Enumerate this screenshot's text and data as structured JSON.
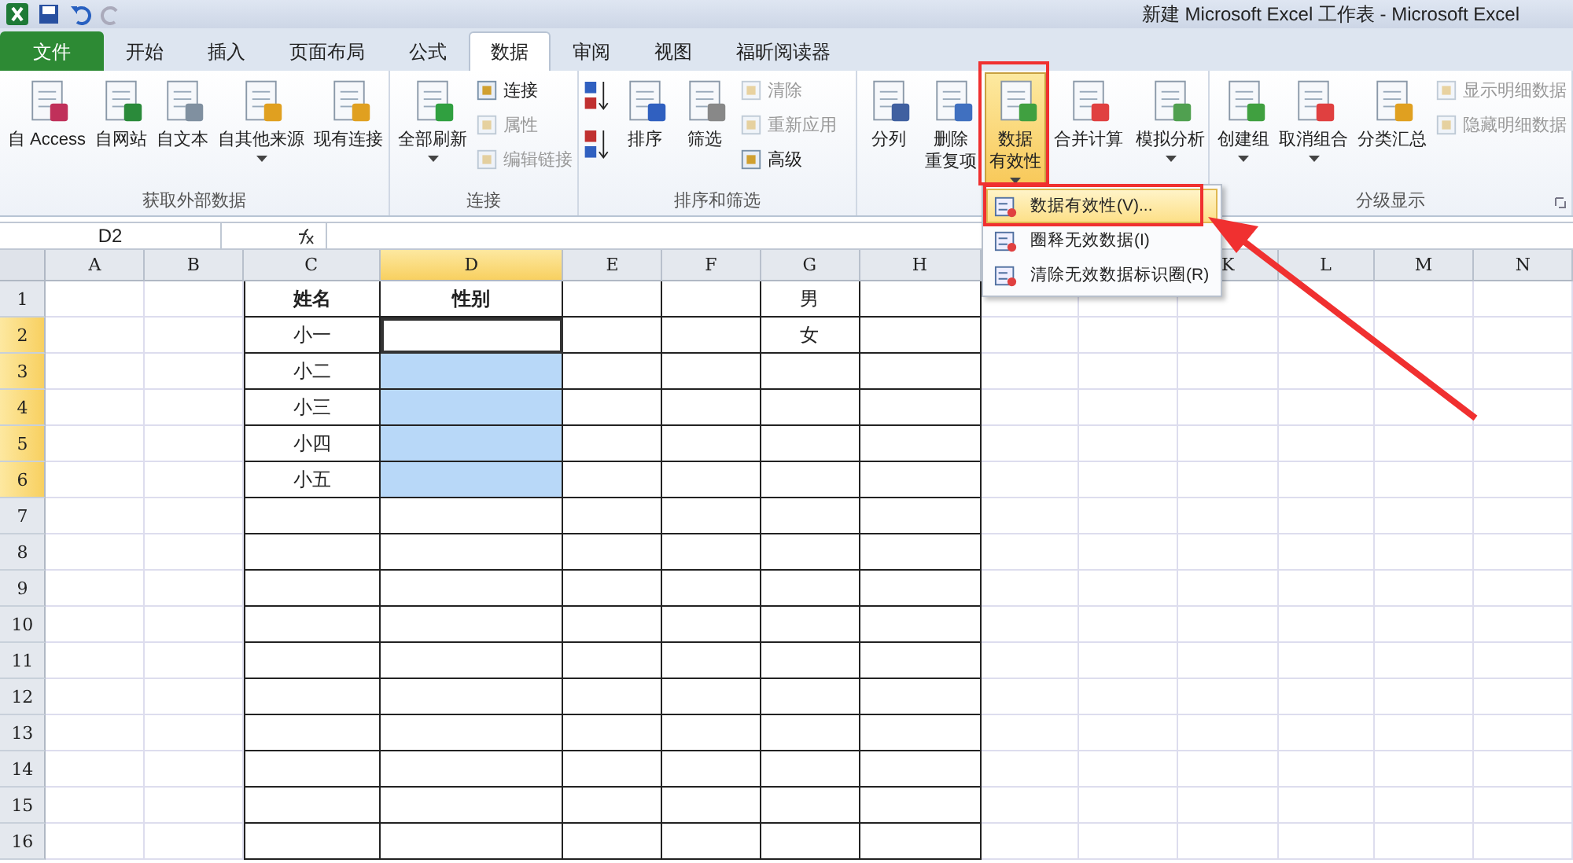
{
  "window": {
    "title": "新建 Microsoft Excel 工作表  -  Microsoft Excel"
  },
  "tabs": [
    {
      "label": "文件",
      "kind": "file",
      "selected": false
    },
    {
      "label": "开始",
      "kind": "tab",
      "selected": false
    },
    {
      "label": "插入",
      "kind": "tab",
      "selected": false
    },
    {
      "label": "页面布局",
      "kind": "tab",
      "selected": false
    },
    {
      "label": "公式",
      "kind": "tab",
      "selected": false
    },
    {
      "label": "数据",
      "kind": "tab",
      "selected": true
    },
    {
      "label": "审阅",
      "kind": "tab",
      "selected": false
    },
    {
      "label": "视图",
      "kind": "tab",
      "selected": false
    },
    {
      "label": "福昕阅读器",
      "kind": "tab",
      "selected": false
    }
  ],
  "ribbon": {
    "groups": [
      {
        "label": "获取外部数据",
        "items": [
          {
            "kind": "large",
            "lines": [
              "自 Access"
            ],
            "dropdown": false,
            "disabled": false,
            "pressed": false
          },
          {
            "kind": "large",
            "lines": [
              "自网站"
            ],
            "dropdown": false,
            "disabled": false,
            "pressed": false
          },
          {
            "kind": "large",
            "lines": [
              "自文本"
            ],
            "dropdown": false,
            "disabled": false,
            "pressed": false
          },
          {
            "kind": "large",
            "lines": [
              "自其他来源"
            ],
            "dropdown": true,
            "disabled": false,
            "pressed": false
          },
          {
            "kind": "large",
            "lines": [
              "现有连接"
            ],
            "dropdown": false,
            "disabled": false,
            "pressed": false
          }
        ]
      },
      {
        "label": "连接",
        "items": [
          {
            "kind": "large",
            "lines": [
              "全部刷新"
            ],
            "dropdown": true,
            "disabled": false,
            "pressed": false
          },
          {
            "kind": "stack",
            "items": [
              {
                "label": "连接",
                "disabled": false
              },
              {
                "label": "属性",
                "disabled": true
              },
              {
                "label": "编辑链接",
                "disabled": true
              }
            ]
          }
        ]
      },
      {
        "label": "排序和筛选",
        "items": [
          {
            "kind": "sortstack"
          },
          {
            "kind": "large",
            "lines": [
              "排序"
            ],
            "dropdown": false,
            "disabled": false,
            "pressed": false
          },
          {
            "kind": "large",
            "lines": [
              "筛选"
            ],
            "dropdown": false,
            "disabled": false,
            "pressed": false
          },
          {
            "kind": "stack",
            "items": [
              {
                "label": "清除",
                "disabled": true
              },
              {
                "label": "重新应用",
                "disabled": true
              },
              {
                "label": "高级",
                "disabled": false
              }
            ]
          }
        ]
      },
      {
        "items": [
          {
            "kind": "large",
            "lines": [
              "分列"
            ],
            "dropdown": false,
            "disabled": false,
            "pressed": false
          },
          {
            "kind": "large",
            "lines": [
              "删除",
              "重复项"
            ],
            "dropdown": false,
            "disabled": false,
            "pressed": false
          },
          {
            "kind": "large",
            "lines": [
              "数据",
              "有效性"
            ],
            "dropdown": true,
            "disabled": false,
            "pressed": true
          },
          {
            "kind": "large",
            "lines": [
              "合并计算"
            ],
            "dropdown": false,
            "disabled": false,
            "pressed": false
          },
          {
            "kind": "large",
            "lines": [
              "模拟分析"
            ],
            "dropdown": true,
            "disabled": false,
            "pressed": false
          }
        ]
      },
      {
        "label": "分级显示",
        "launcher": true,
        "items": [
          {
            "kind": "large",
            "lines": [
              "创建组"
            ],
            "dropdown": true,
            "disabled": false,
            "pressed": false
          },
          {
            "kind": "large",
            "lines": [
              "取消组合"
            ],
            "dropdown": true,
            "disabled": false,
            "pressed": false
          },
          {
            "kind": "large",
            "lines": [
              "分类汇总"
            ],
            "dropdown": false,
            "disabled": false,
            "pressed": false
          },
          {
            "kind": "stack",
            "items": [
              {
                "label": "显示明细数据",
                "disabled": true
              },
              {
                "label": "隐藏明细数据",
                "disabled": true
              }
            ]
          }
        ]
      }
    ]
  },
  "formula_bar": {
    "name_box": "D2"
  },
  "sheet": {
    "columns": [
      {
        "label": "A",
        "selected": false
      },
      {
        "label": "B",
        "selected": false
      },
      {
        "label": "C",
        "selected": false
      },
      {
        "label": "D",
        "selected": true
      },
      {
        "label": "E",
        "selected": false
      },
      {
        "label": "F",
        "selected": false
      },
      {
        "label": "G",
        "selected": false
      },
      {
        "label": "H",
        "selected": false
      },
      {},
      {},
      {
        "label": "K",
        "selected": false
      },
      {
        "label": "L",
        "selected": false
      },
      {
        "label": "M",
        "selected": false
      },
      {
        "label": "N",
        "selected": false
      }
    ],
    "rows": [
      {
        "number": "1",
        "selected": false,
        "cells": [
          {},
          {},
          {
            "text": "姓名",
            "bold": true
          },
          {
            "text": "性别",
            "bold": true,
            "selected": false
          },
          {},
          {},
          {
            "text": "男",
            "bold": false
          }
        ]
      },
      {
        "number": "2",
        "selected": true,
        "cells": [
          {},
          {},
          {
            "text": "小一",
            "bold": false
          },
          {
            "selected": false,
            "active": true
          },
          {},
          {},
          {
            "text": "女",
            "bold": false
          }
        ]
      },
      {
        "number": "3",
        "selected": true,
        "cells": [
          {},
          {},
          {
            "text": "小二",
            "bold": false
          },
          {
            "selected": true
          }
        ]
      },
      {
        "number": "4",
        "selected": true,
        "cells": [
          {},
          {},
          {
            "text": "小三",
            "bold": false
          },
          {
            "selected": true
          }
        ]
      },
      {
        "number": "5",
        "selected": true,
        "cells": [
          {},
          {},
          {
            "text": "小四",
            "bold": false
          },
          {
            "selected": true
          }
        ]
      },
      {
        "number": "6",
        "selected": true,
        "cells": [
          {},
          {},
          {
            "text": "小五",
            "bold": false
          },
          {
            "selected": true
          }
        ]
      },
      {
        "number": "7",
        "selected": false
      },
      {
        "number": "8",
        "selected": false
      },
      {
        "number": "9",
        "selected": false
      },
      {
        "number": "10",
        "selected": false
      },
      {
        "number": "11",
        "selected": false
      },
      {
        "number": "12",
        "selected": false
      },
      {
        "number": "13",
        "selected": false
      },
      {
        "number": "14",
        "selected": false
      },
      {
        "number": "15",
        "selected": false
      },
      {
        "number": "16",
        "selected": false
      }
    ]
  },
  "dropdown_menu": {
    "items": [
      {
        "label": "数据有效性(V)...",
        "selected": true
      },
      {
        "label": "圈释无效数据(I)",
        "selected": false
      },
      {
        "label": "清除无效数据标识圈(R)",
        "selected": false
      }
    ]
  }
}
